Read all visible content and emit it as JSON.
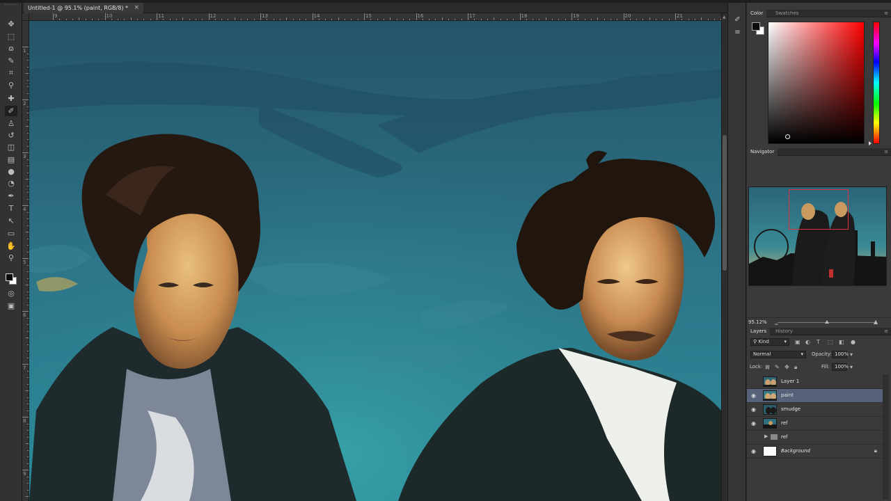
{
  "document": {
    "tab_title": "Untitled-1 @ 95.1% (paint, RGB/8) *",
    "close_glyph": "×"
  },
  "rulers": {
    "top": [
      "9",
      "10",
      "11",
      "12",
      "13",
      "14",
      "15",
      "16",
      "17",
      "18",
      "19",
      "20",
      "21"
    ],
    "left": [
      "1",
      "2",
      "3",
      "4",
      "5",
      "6",
      "7",
      "8",
      "9"
    ]
  },
  "tools": [
    {
      "name": "move-tool-icon",
      "glyph": "✥"
    },
    {
      "name": "marquee-tool-icon",
      "glyph": "⬚"
    },
    {
      "name": "lasso-tool-icon",
      "glyph": "ɷ"
    },
    {
      "name": "quick-select-tool-icon",
      "glyph": "✎"
    },
    {
      "name": "crop-tool-icon",
      "glyph": "⌗"
    },
    {
      "name": "eyedropper-tool-icon",
      "glyph": "⚲"
    },
    {
      "name": "healing-brush-tool-icon",
      "glyph": "✚"
    },
    {
      "name": "brush-tool-icon",
      "glyph": "✐"
    },
    {
      "name": "clone-stamp-tool-icon",
      "glyph": "♙"
    },
    {
      "name": "history-brush-tool-icon",
      "glyph": "↺"
    },
    {
      "name": "eraser-tool-icon",
      "glyph": "◫"
    },
    {
      "name": "gradient-tool-icon",
      "glyph": "▤"
    },
    {
      "name": "blur-tool-icon",
      "glyph": "●"
    },
    {
      "name": "dodge-tool-icon",
      "glyph": "◔"
    },
    {
      "name": "pen-tool-icon",
      "glyph": "✒"
    },
    {
      "name": "type-tool-icon",
      "glyph": "T"
    },
    {
      "name": "path-select-tool-icon",
      "glyph": "↖"
    },
    {
      "name": "shape-tool-icon",
      "glyph": "▭"
    },
    {
      "name": "hand-tool-icon",
      "glyph": "✋"
    },
    {
      "name": "zoom-tool-icon",
      "glyph": "⚲"
    },
    {
      "name": "quick-mask-icon",
      "glyph": "◎"
    },
    {
      "name": "screen-mode-icon",
      "glyph": "▣"
    }
  ],
  "active_tool_index": 7,
  "dock": [
    {
      "name": "dock-brush-icon",
      "glyph": "✐"
    },
    {
      "name": "dock-adjust-icon",
      "glyph": "≡"
    }
  ],
  "panels": {
    "color_tabs": [
      "Color",
      "Swatches"
    ],
    "navigator_tab": "Navigator",
    "zoom_value": "95.12%",
    "layers_tabs": [
      "Layers",
      "History"
    ],
    "filter_kind": "Kind",
    "blend_mode": "Normal",
    "opacity_label": "Opacity:",
    "opacity_value": "100%",
    "lock_label": "Lock:",
    "fill_label": "Fill:",
    "fill_value": "100%",
    "menu_glyph": "≡"
  },
  "colors": {
    "foreground": "#0a0a0a",
    "background": "#ffffff",
    "hue": "#ff0000",
    "selection": "#56627a"
  },
  "layers": [
    {
      "name": "Layer 1",
      "visible": false,
      "selected": false,
      "italic": false
    },
    {
      "name": "paint",
      "visible": true,
      "selected": true,
      "italic": false
    },
    {
      "name": "smudge",
      "visible": true,
      "selected": false,
      "italic": false
    },
    {
      "name": "ref",
      "visible": true,
      "selected": false,
      "italic": false
    },
    {
      "name": "ref",
      "visible": false,
      "selected": false,
      "italic": false,
      "group": true
    },
    {
      "name": "Background",
      "visible": true,
      "selected": false,
      "italic": true,
      "locked": true
    }
  ]
}
